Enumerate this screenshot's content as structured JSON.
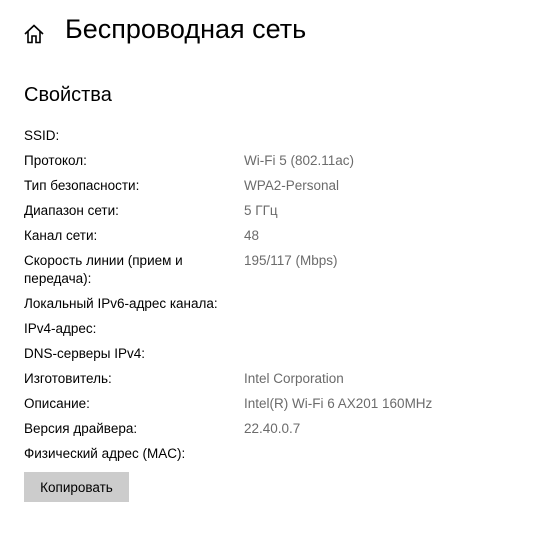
{
  "header": {
    "home_icon": "home-icon",
    "title": "Беспроводная сеть"
  },
  "section": {
    "title": "Свойства"
  },
  "properties": [
    {
      "label": "SSID:",
      "value": ""
    },
    {
      "label": "Протокол:",
      "value": "Wi-Fi 5 (802.11ac)"
    },
    {
      "label": "Тип безопасности:",
      "value": "WPA2-Personal"
    },
    {
      "label": "Диапазон сети:",
      "value": "5 ГГц"
    },
    {
      "label": "Канал сети:",
      "value": "48"
    },
    {
      "label": "Скорость линии (прием и передача):",
      "value": "195/117 (Mbps)"
    },
    {
      "label": "Локальный IPv6-адрес канала:",
      "value": ""
    },
    {
      "label": "IPv4-адрес:",
      "value": ""
    },
    {
      "label": "DNS-серверы IPv4:",
      "value": ""
    },
    {
      "label": "Изготовитель:",
      "value": "Intel Corporation"
    },
    {
      "label": "Описание:",
      "value": "Intel(R) Wi-Fi 6 AX201 160MHz"
    },
    {
      "label": "Версия драйвера:",
      "value": "22.40.0.7"
    },
    {
      "label": "Физический адрес (MAC):",
      "value": ""
    }
  ],
  "actions": {
    "copy_label": "Копировать"
  }
}
